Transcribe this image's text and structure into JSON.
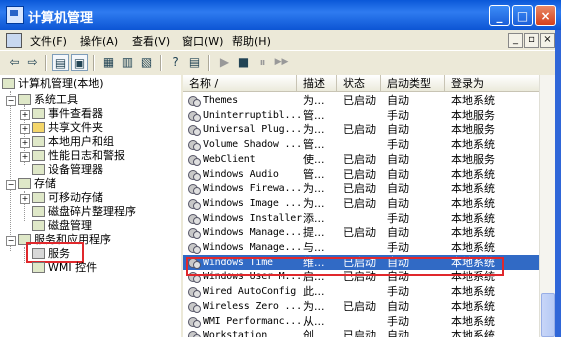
{
  "window": {
    "title": "计算机管理",
    "min_glyph": "_",
    "max_glyph": "□",
    "close_glyph": "×"
  },
  "menubar": {
    "items": [
      "文件(F)",
      "操作(A)",
      "查看(V)",
      "窗口(W)",
      "帮助(H)"
    ],
    "mdi": {
      "min": "_",
      "restore": "▫",
      "close": "×"
    }
  },
  "toolbar": {
    "glyphs": [
      "⇦",
      "⇨",
      "▤",
      "▣",
      "▦",
      "▥",
      "▧",
      "?",
      "▤",
      "▶",
      "■",
      "⏸",
      "▶▶"
    ]
  },
  "tree": {
    "nodes": [
      {
        "label": "计算机管理(本地)",
        "expander": ""
      },
      {
        "label": "系统工具",
        "expander": "−"
      },
      {
        "label": "事件查看器",
        "expander": "+"
      },
      {
        "label": "共享文件夹",
        "expander": "+"
      },
      {
        "label": "本地用户和组",
        "expander": "+"
      },
      {
        "label": "性能日志和警报",
        "expander": "+"
      },
      {
        "label": "设备管理器",
        "expander": ""
      },
      {
        "label": "存储",
        "expander": "−"
      },
      {
        "label": "可移动存储",
        "expander": "+"
      },
      {
        "label": "磁盘碎片整理程序",
        "expander": ""
      },
      {
        "label": "磁盘管理",
        "expander": ""
      },
      {
        "label": "服务和应用程序",
        "expander": "−"
      },
      {
        "label": "服务",
        "expander": ""
      },
      {
        "label": "WMI 控件",
        "expander": ""
      }
    ]
  },
  "list": {
    "columns": [
      "名称 /",
      "描述",
      "状态",
      "启动类型",
      "登录为"
    ],
    "rows": [
      {
        "name": "Themes",
        "desc": "为...",
        "status": "已启动",
        "startup": "自动",
        "logon": "本地系统"
      },
      {
        "name": "Uninterruptibl...",
        "desc": "管...",
        "status": "",
        "startup": "手动",
        "logon": "本地服务"
      },
      {
        "name": "Universal Plug...",
        "desc": "为...",
        "status": "已启动",
        "startup": "自动",
        "logon": "本地服务"
      },
      {
        "name": "Volume Shadow ...",
        "desc": "管...",
        "status": "",
        "startup": "手动",
        "logon": "本地系统"
      },
      {
        "name": "WebClient",
        "desc": "使...",
        "status": "已启动",
        "startup": "自动",
        "logon": "本地服务"
      },
      {
        "name": "Windows Audio",
        "desc": "管...",
        "status": "已启动",
        "startup": "自动",
        "logon": "本地系统"
      },
      {
        "name": "Windows Firewa...",
        "desc": "为...",
        "status": "已启动",
        "startup": "自动",
        "logon": "本地系统"
      },
      {
        "name": "Windows Image ...",
        "desc": "为...",
        "status": "已启动",
        "startup": "自动",
        "logon": "本地系统"
      },
      {
        "name": "Windows Installer",
        "desc": "添...",
        "status": "",
        "startup": "手动",
        "logon": "本地系统"
      },
      {
        "name": "Windows Manage...",
        "desc": "提...",
        "status": "已启动",
        "startup": "自动",
        "logon": "本地系统"
      },
      {
        "name": "Windows Manage...",
        "desc": "与...",
        "status": "",
        "startup": "手动",
        "logon": "本地系统"
      },
      {
        "name": "Windows Time",
        "desc": "维...",
        "status": "已启动",
        "startup": "自动",
        "logon": "本地系统"
      },
      {
        "name": "Windows User M...",
        "desc": "启...",
        "status": "已启动",
        "startup": "自动",
        "logon": "本地系统"
      },
      {
        "name": "Wired AutoConfig",
        "desc": "此...",
        "status": "",
        "startup": "手动",
        "logon": "本地系统"
      },
      {
        "name": "Wireless Zero ...",
        "desc": "为...",
        "status": "已启动",
        "startup": "自动",
        "logon": "本地系统"
      },
      {
        "name": "WMI Performanc...",
        "desc": "从...",
        "status": "",
        "startup": "手动",
        "logon": "本地系统"
      },
      {
        "name": "Workstation",
        "desc": "创...",
        "status": "已启动",
        "startup": "自动",
        "logon": "本地系统"
      }
    ]
  },
  "colors": {
    "selection": "#316ac5",
    "highlight_box": "#e0282c",
    "titlebar": "#0a58d8"
  }
}
